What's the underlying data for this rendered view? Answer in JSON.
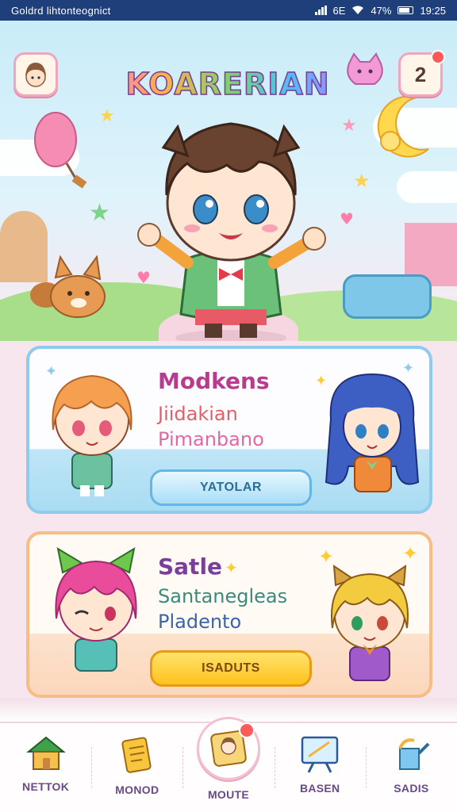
{
  "status_bar": {
    "carrier": "Goldrd lihtonteognict",
    "network": "6E",
    "battery": "47%",
    "time": "19:25"
  },
  "header": {
    "title": "KOARERIAN",
    "profile_icon": "avatar-icon",
    "notifications": {
      "icon": "bell-icon",
      "count": "2"
    }
  },
  "cards": [
    {
      "title": "Modkens",
      "line1": "Jiidakian",
      "line2": "Pimanbano",
      "button_label": "YATOLAR",
      "title_color": "#b83b8f",
      "line1_color": "#e0616a",
      "line2_color": "#e06aa3"
    },
    {
      "title": "Satle",
      "line1": "Santanegleas",
      "line2": "Pladento",
      "button_label": "ISADUTS",
      "title_color": "#7a3f9a",
      "line1_color": "#3c8a7e",
      "line2_color": "#3a66a8"
    }
  ],
  "nav": {
    "items": [
      {
        "label": "NETTOK",
        "icon": "house-icon"
      },
      {
        "label": "MONOD",
        "icon": "scroll-icon"
      },
      {
        "label": "MOUTE",
        "icon": "photo-card-icon",
        "active": true
      },
      {
        "label": "BASEN",
        "icon": "easel-icon"
      },
      {
        "label": "SADIS",
        "icon": "watering-can-icon"
      }
    ]
  },
  "colors": {
    "status_bar": "#1f3f7a",
    "card1_border": "#8ecbed",
    "card2_border": "#f6bd84",
    "nav_label": "#6a4a86"
  }
}
